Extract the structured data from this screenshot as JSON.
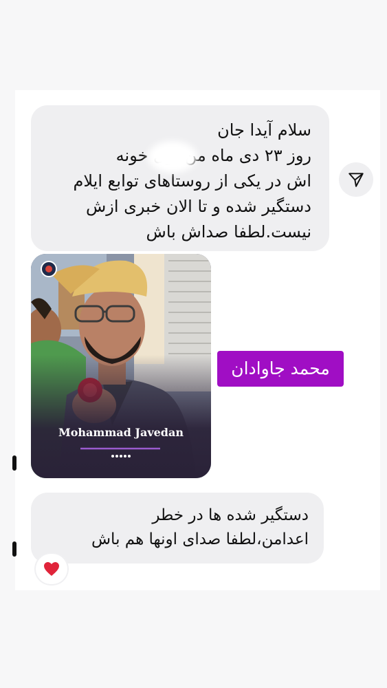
{
  "messages": {
    "first": {
      "greeting": "سلام آیدا جان",
      "lines": [
        "روز ۲۳ دی ماه        من توی خونه",
        "اش در یکی از روستاهای توابع ایلام",
        "دستگیر شده و تا الان خبری ازش",
        "نیست.لطفا صداش باش"
      ]
    },
    "photo": {
      "caption": "Mohammad Javedan"
    },
    "name_tag": "محمد جاوادان",
    "last": {
      "lines": [
        "دستگیر شده ها در خطر",
        "اعدامن،لطفا صدای اونها هم باش"
      ]
    }
  },
  "icons": {
    "share": "share-send-icon",
    "reaction": "heart-icon"
  },
  "colors": {
    "bubble": "#efeff1",
    "name_tag": "#a00ec4",
    "heart": "#e0243a"
  }
}
